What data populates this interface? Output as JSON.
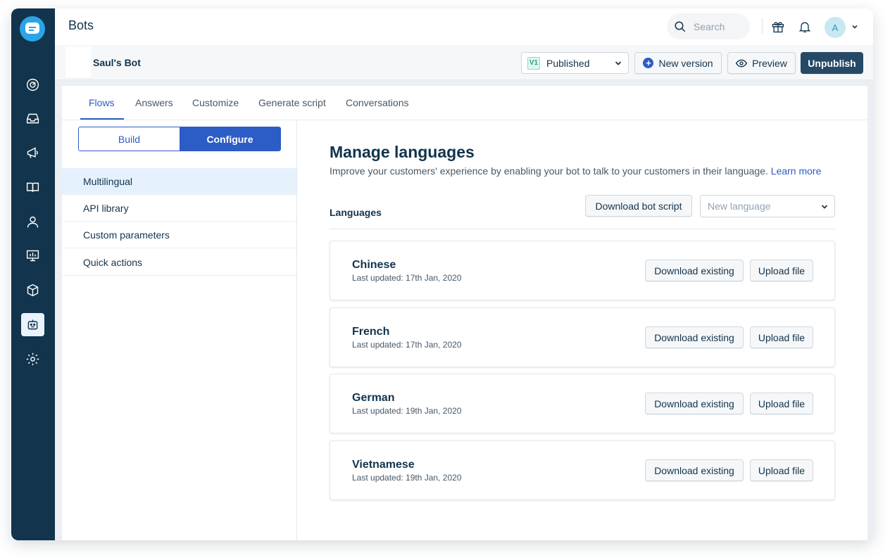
{
  "topbar": {
    "title": "Bots",
    "search_placeholder": "Search",
    "avatar_initial": "A"
  },
  "sidebar": {
    "items": [
      "dashboard",
      "inbox",
      "campaigns",
      "knowledge-base",
      "contacts",
      "reports",
      "apps",
      "bots",
      "settings"
    ],
    "active": "bots"
  },
  "subheader": {
    "bot_name": "Saul's Bot",
    "version_badge": "V1",
    "version_status": "Published",
    "new_version_label": "New version",
    "preview_label": "Preview",
    "unpublish_label": "Unpublish"
  },
  "tabs": [
    {
      "label": "Flows",
      "active": true
    },
    {
      "label": "Answers"
    },
    {
      "label": "Customize"
    },
    {
      "label": "Generate script"
    },
    {
      "label": "Conversations"
    }
  ],
  "mode_toggle": {
    "build": "Build",
    "configure": "Configure",
    "selected": "Configure"
  },
  "left_menu": [
    {
      "label": "Multilingual",
      "active": true
    },
    {
      "label": "API library"
    },
    {
      "label": "Custom parameters"
    },
    {
      "label": "Quick actions"
    }
  ],
  "main": {
    "title": "Manage languages",
    "description": "Improve your customers' experience by enabling your bot to talk to your customers in their language.",
    "learn_more": "Learn more",
    "languages_label": "Languages",
    "download_script_label": "Download bot script",
    "new_language_placeholder": "New language",
    "download_existing_label": "Download existing",
    "upload_label": "Upload file",
    "languages": [
      {
        "name": "Chinese",
        "updated": "Last updated: 17th Jan, 2020"
      },
      {
        "name": "French",
        "updated": "Last updated: 17th Jan, 2020"
      },
      {
        "name": "German",
        "updated": "Last updated: 19th Jan, 2020"
      },
      {
        "name": "Vietnamese",
        "updated": "Last updated: 19th Jan, 2020"
      }
    ]
  },
  "colors": {
    "sidebar": "#12344d",
    "primary": "#2c5cc5",
    "unpublish": "#264966",
    "logo": "#2ba4e8"
  }
}
